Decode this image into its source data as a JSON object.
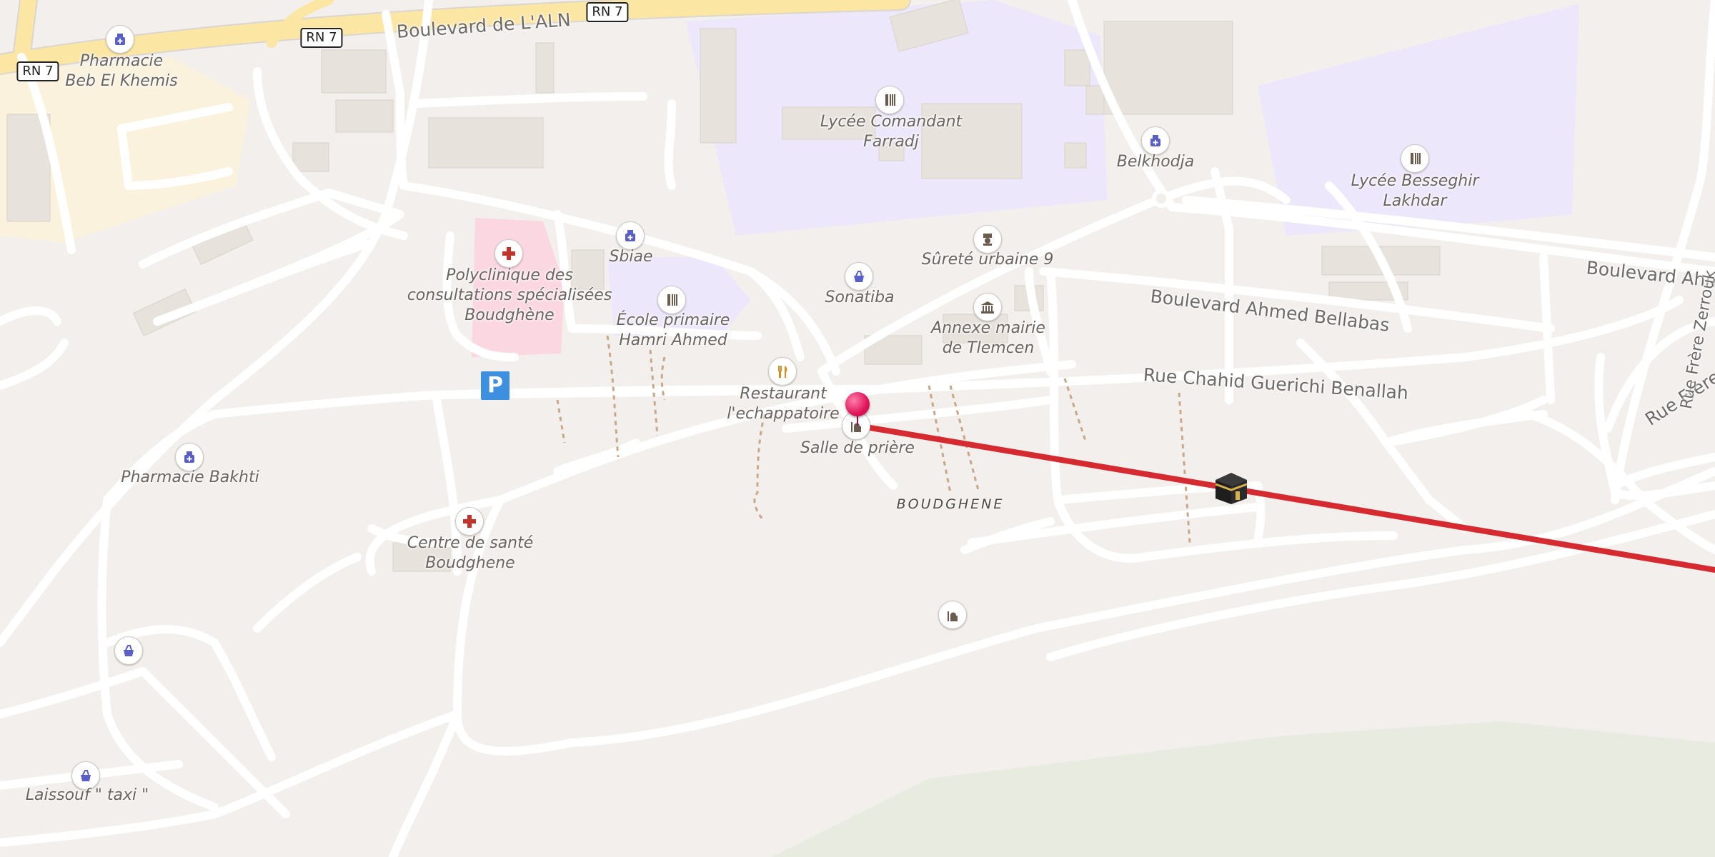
{
  "map": {
    "roads": {
      "boulevard_aln": "Boulevard de L'ALN",
      "rn7": "RN 7",
      "ahmed_bellabas": "Boulevard Ahmed Bellabas",
      "ahmed_right": "Boulevard Ahm",
      "guerichi": "Rue Chahid Guerichi Benallah",
      "frere_zerrouk": "Rue Frère Zerrouk",
      "zerrouk_vertical": "Rue Frère Zerrouk"
    },
    "district": "BOUDGHENE",
    "pois": {
      "pharmacie_beb": "Pharmacie\nBeb El Khemis",
      "lycee_farradj": "Lycée Comandant\nFarradj",
      "belkhodja": "Belkhodja",
      "lycee_besseghir": "Lycée Besseghir\nLakhdar",
      "polyclinique": "Polyclinique des\nconsultations spécialisées\nBoudghène",
      "sbiae": "Sbiae",
      "ecole_hamri": "École primaire\nHamri Ahmed",
      "surete": "Sûreté urbaine 9",
      "sonatiba": "Sonatiba",
      "annexe_mairie": "Annexe mairie\nde Tlemcen",
      "restaurant": "Restaurant\nl'echappatoire",
      "salle_priere": "Salle de prière",
      "pharmacie_bakhti": "Pharmacie Bakhti",
      "centre_sante": "Centre de santé\nBoudghene",
      "laissouf": "Laissouf \" taxi \""
    },
    "icons": {
      "pharmacy": "pharmacy-icon",
      "school": "school-icon",
      "hospital": "hospital-icon",
      "police": "police-icon",
      "townhall": "townhall-icon",
      "restaurant": "restaurant-icon",
      "mosque": "mosque-icon",
      "shop": "shop-icon",
      "parking": "parking-icon",
      "parking_letter": "P",
      "pin": "location-pin-icon",
      "kaaba": "kaaba-icon"
    },
    "colors": {
      "background": "#f2efec",
      "road": "#ffffff",
      "major_road": "#fbe6a3",
      "school_area": "#ece7fb",
      "hospital_area": "#fbd7e2",
      "building": "#e8e2dc",
      "qibla_line": "#d52a30",
      "pin": "#e0145a",
      "parking": "#3d8fe0",
      "poi_school": "#6b5a4e",
      "poi_pharmacy": "#5a5fc8",
      "poi_hospital": "#c0342b",
      "poi_restaurant": "#d78a1c"
    }
  }
}
